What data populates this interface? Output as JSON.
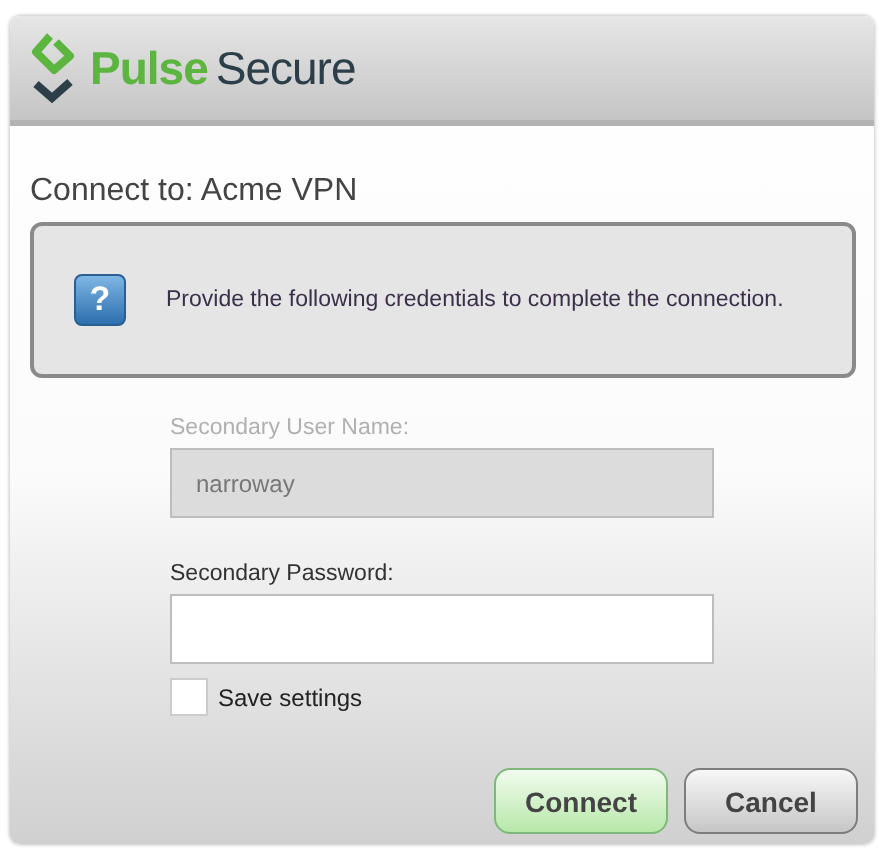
{
  "logo": {
    "brand_primary": "Pulse",
    "brand_secondary": "Secure"
  },
  "heading": "Connect to: Acme VPN",
  "info": {
    "message": "Provide the following credentials to complete the connection.",
    "icon_glyph": "?"
  },
  "fields": [
    {
      "label": "Secondary User Name:",
      "value": "narroway",
      "disabled": true
    },
    {
      "label": "Secondary Password:",
      "disabled": false
    }
  ],
  "save_settings": {
    "label": "Save settings",
    "checked": false
  },
  "buttons": [
    {
      "label": "Connect",
      "kind": "primary"
    },
    {
      "label": "Cancel",
      "kind": "secondary"
    }
  ]
}
